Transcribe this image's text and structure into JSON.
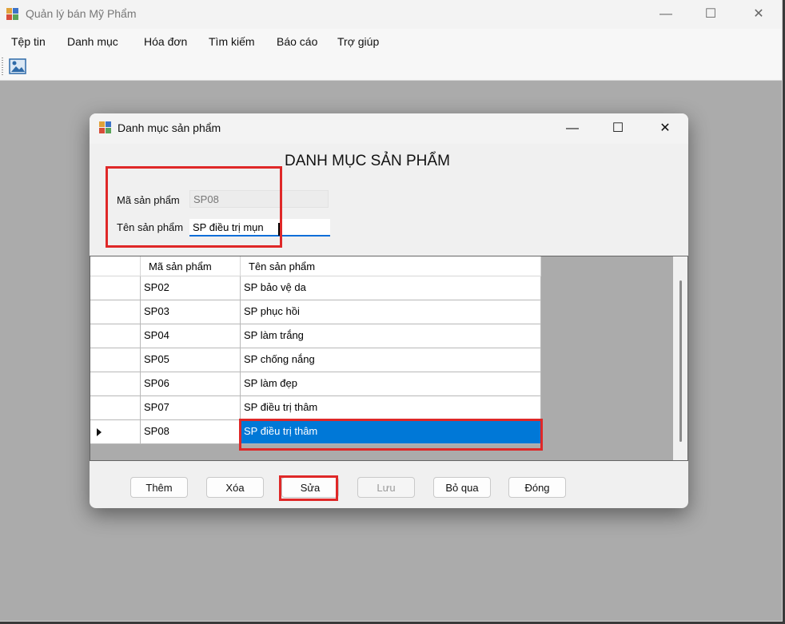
{
  "app": {
    "title": "Quản lý bán Mỹ Phẩm",
    "menu": [
      "Tệp tin",
      "Danh mục",
      "Hóa đơn",
      "Tìm kiếm",
      "Báo cáo",
      "Trợ giúp"
    ],
    "window_controls": {
      "minimize": "—",
      "maximize": "☐",
      "close": "✕"
    }
  },
  "dialog": {
    "title": "Danh mục sản phẩm",
    "heading": "DANH MỤC SẢN PHẨM",
    "controls": {
      "minimize": "—",
      "maximize": "☐",
      "close": "✕"
    },
    "fields": {
      "ma_label": "Mã sản phẩm",
      "ma_value": "SP08",
      "ten_label": "Tên sản phẩm",
      "ten_value": "SP điều trị mụn"
    },
    "grid": {
      "columns": [
        "Mã sản phẩm",
        "Tên sản phẩm"
      ],
      "rows": [
        {
          "ma": "SP02",
          "ten": "SP bảo vệ da"
        },
        {
          "ma": "SP03",
          "ten": "SP phục hồi"
        },
        {
          "ma": "SP04",
          "ten": "SP làm trắng"
        },
        {
          "ma": "SP05",
          "ten": "SP chống nắng"
        },
        {
          "ma": "SP06",
          "ten": "SP làm đẹp"
        },
        {
          "ma": "SP07",
          "ten": "SP điều trị thâm"
        },
        {
          "ma": "SP08",
          "ten": "SP điều trị thâm"
        }
      ],
      "selected_row": "SP08"
    },
    "buttons": {
      "them": "Thêm",
      "xoa": "Xóa",
      "sua": "Sửa",
      "luu": "Lưu",
      "bo_qua": "Bỏ qua",
      "dong": "Đóng"
    }
  },
  "colors": {
    "selection": "#0078d7",
    "highlight_box": "#df2828",
    "focus_underline": "#0b6ed9"
  },
  "icons": [
    "app-icon",
    "image-icon",
    "row-pointer-icon"
  ]
}
